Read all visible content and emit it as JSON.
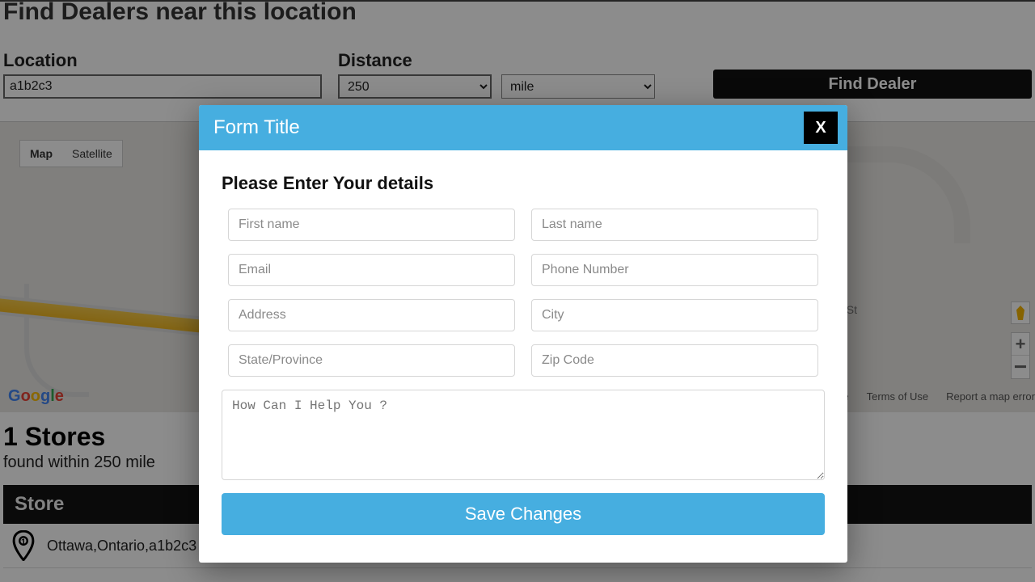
{
  "page": {
    "title": "Find Dealers near this location",
    "location_label": "Location",
    "location_value": "a1b2c3",
    "distance_label": "Distance",
    "distance_value": "250",
    "unit_value": "mile",
    "find_button": "Find Dealer",
    "map_tab_map": "Map",
    "map_tab_satellite": "Satellite",
    "map_street_label": "St",
    "map_terms": "Terms of Use",
    "map_report": "Report a map error",
    "results_title": "1 Stores",
    "results_sub": "found within 250 mile",
    "store_header": "Store",
    "store_row_text": "Ottawa,Ontario,a1b2c3"
  },
  "modal": {
    "title": "Form Title",
    "close": "X",
    "subtitle": "Please Enter Your details",
    "placeholders": {
      "first_name": "First name",
      "last_name": "Last name",
      "email": "Email",
      "phone": "Phone Number",
      "address": "Address",
      "city": "City",
      "state": "State/Province",
      "zip": "Zip Code",
      "message": "How Can I Help You ?"
    },
    "save": "Save Changes"
  }
}
